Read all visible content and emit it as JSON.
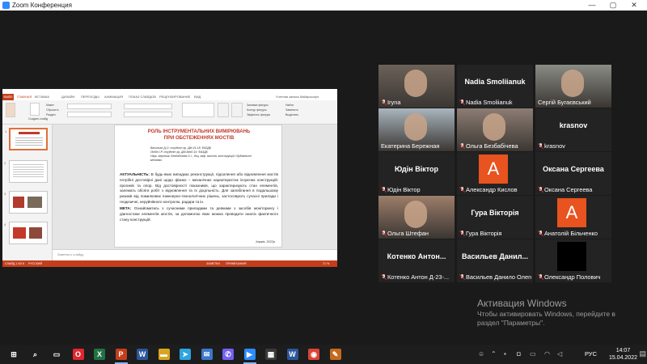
{
  "window": {
    "title": "Zoom Конференция",
    "controls": [
      "—",
      "▢",
      "✕"
    ]
  },
  "ppt": {
    "tabs": [
      "ФАЙЛ",
      "ГЛАВНАЯ",
      "ВСТАВКА",
      "ДИЗАЙН",
      "ПЕРЕХОДЫ",
      "АНИМАЦИЯ",
      "ПОКАЗ СЛАЙДОВ",
      "РЕЦЕНЗИРОВАНИЕ",
      "ВИД"
    ],
    "user": "Учетная запись Майкрософт",
    "ribbon_buttons": [
      "Создать слайд",
      "Макет",
      "Сбросить",
      "Раздел",
      "Заливка фигуры",
      "Контур фигуры",
      "Эффекты фигуры",
      "Найти",
      "Заменить",
      "Выделить"
    ],
    "slide": {
      "title_line1": "РОЛЬ ІНСТРУМЕНТАЛЬНИХ ВИМІРЮВАНЬ",
      "title_line2": "ПРИ ОБСТЕЖЕННЯХ МОСТІВ",
      "authors": [
        "Васильєв Д.О. студент гр. ДМ-41-18, ФАЗДБ",
        "Любін І.Р. студент гр. ДМ-МмЛ-19, ФАЗДБ",
        "Наук. керівник: Безбабічева О.І., доц. каф. мостів, конструкцій і будівельної механіки"
      ],
      "actual_label": "АКТУАЛЬНІСТЬ:",
      "actual_text": "В будь-яких випадках реконструкції, підсилення або відновлення мостів потрібні достовірні дані щодо фізико – механічних характеристик існуючих конструкцій: прогинів та опор. Від достовірності показників, що характеризують стан елементів, залежать обсяги робіт з відновлення та їх доцільність. Для запобігання в подальшому ризиків від помилкових інженерно-технологічних рішень, застосовують сучасні прилади і геодезичні, неруйнівного контролю, радари та ін.",
      "meta_label": "МЕТА:",
      "meta_text": "Ознайомитись з сучасними приладами та деякими з засобів моніторингу і діагностики елементів мостів, за допомогою яких можна проводити аналіз фактичного стану конструкцій.",
      "city": "Харків, 2022р"
    },
    "notes": "Заметки к слайду",
    "status_left": "СЛАЙД 1 ИЗ 8",
    "status_lang": "РУССКИЙ",
    "status_right": [
      "ЗАМЕТКИ",
      "ПРИМЕЧАНИЯ"
    ],
    "zoom": "71 %"
  },
  "participants": [
    {
      "label": "Iryna",
      "display_name": "",
      "muted": true,
      "kind": "video",
      "bg": "#6b6259"
    },
    {
      "label": "Nadia Smoliianuk",
      "display_name": "Nadia Smoliianuk",
      "muted": true,
      "kind": "name"
    },
    {
      "label": "Сергій Бугаєвський",
      "display_name": "",
      "muted": false,
      "kind": "video",
      "bg": "#8a8c86",
      "speaking": true
    },
    {
      "label": "Екатерина Бережная",
      "display_name": "",
      "muted": false,
      "kind": "video",
      "bg": "#a9b5bd"
    },
    {
      "label": "Ольга Безбабічева",
      "display_name": "",
      "muted": true,
      "kind": "video",
      "bg": "#8d7d74"
    },
    {
      "label": "krasnov",
      "display_name": "krasnov",
      "muted": true,
      "kind": "name"
    },
    {
      "label": "Юдін Віктор",
      "display_name": "Юдін Віктор",
      "muted": true,
      "kind": "name"
    },
    {
      "label": "Александр Кислов",
      "display_name": "",
      "muted": true,
      "kind": "avatar",
      "letter": "A"
    },
    {
      "label": "Оксана Сергеева",
      "display_name": "Оксана Сергеева",
      "muted": true,
      "kind": "name"
    },
    {
      "label": "Ольга Штефан",
      "display_name": "",
      "muted": true,
      "kind": "video",
      "bg": "#9d7e6a"
    },
    {
      "label": "Гура Вікторія",
      "display_name": "Гура Вікторія",
      "muted": true,
      "kind": "name"
    },
    {
      "label": "Анатолій Більченко",
      "display_name": "",
      "muted": true,
      "kind": "avatar",
      "letter": "A"
    },
    {
      "label": "Котенко Антон Д-23-...",
      "display_name": "Котенко Антон...",
      "muted": true,
      "kind": "name"
    },
    {
      "label": "Васильев Данило Олего...",
      "display_name": "Васильев Данил...",
      "muted": true,
      "kind": "name"
    },
    {
      "label": "Олександр Полович",
      "display_name": "",
      "muted": true,
      "kind": "black"
    }
  ],
  "activation": {
    "title": "Активация Windows",
    "line1": "Чтобы активировать Windows, перейдите в",
    "line2": "раздел \"Параметры\"."
  },
  "taskbar": {
    "apps": [
      {
        "name": "windows-start-icon",
        "glyph": "⊞",
        "color": "#1d1d1d"
      },
      {
        "name": "search-icon",
        "glyph": "⌕",
        "color": "#1d1d1d"
      },
      {
        "name": "task-view-icon",
        "glyph": "▭",
        "color": "#1d1d1d"
      },
      {
        "name": "opera-icon",
        "glyph": "O",
        "color": "#e0262e"
      },
      {
        "name": "excel-icon",
        "glyph": "X",
        "color": "#1f7244"
      },
      {
        "name": "powerpoint-icon",
        "glyph": "P",
        "color": "#c43e1c"
      },
      {
        "name": "word-shortcut-icon",
        "glyph": "W",
        "color": "#2b579a"
      },
      {
        "name": "explorer-icon",
        "glyph": "▬",
        "color": "#d9a520"
      },
      {
        "name": "telegram-icon",
        "glyph": "➤",
        "color": "#2ca5e0"
      },
      {
        "name": "mail-icon",
        "glyph": "✉",
        "color": "#3a78c9"
      },
      {
        "name": "viber-icon",
        "glyph": "✆",
        "color": "#7360f2"
      },
      {
        "name": "zoom-icon",
        "glyph": "▶",
        "color": "#2d8cff"
      },
      {
        "name": "store-icon",
        "glyph": "▦",
        "color": "#3a3a3a"
      },
      {
        "name": "word-icon",
        "glyph": "W",
        "color": "#2b579a"
      },
      {
        "name": "chrome-icon",
        "glyph": "◉",
        "color": "#db4437"
      },
      {
        "name": "paint-icon",
        "glyph": "✎",
        "color": "#c46a1c"
      }
    ],
    "lang": "РУС",
    "time": "14:07",
    "date": "15.04.2022"
  }
}
